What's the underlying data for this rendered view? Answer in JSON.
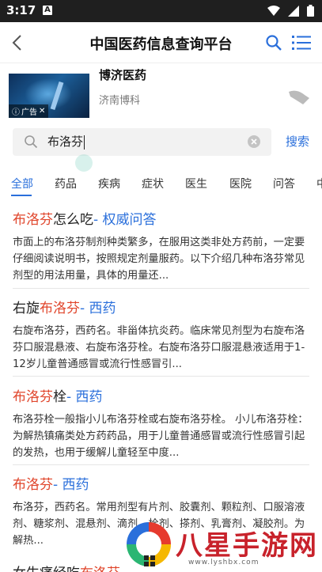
{
  "status_bar": {
    "time": "3:17",
    "badge": "A"
  },
  "nav": {
    "title": "中国医药信息查询平台"
  },
  "ad": {
    "title": "博济医药",
    "subtitle": "济南博科",
    "badge": "广告"
  },
  "search": {
    "value": "布洛芬",
    "button": "搜索"
  },
  "tabs": [
    {
      "label": "全部",
      "active": true
    },
    {
      "label": "药品"
    },
    {
      "label": "疾病"
    },
    {
      "label": "症状"
    },
    {
      "label": "医生"
    },
    {
      "label": "医院"
    },
    {
      "label": "问答"
    },
    {
      "label": "中"
    }
  ],
  "results": [
    {
      "title_hl": "布洛芬",
      "title_plain": "怎么吃",
      "title_tag": "- 权威问答",
      "body": "市面上的布洛芬制剂种类繁多，在服用这类非处方药前，一定要仔细阅读说明书，按照规定剂量服药。以下介绍几种布洛芬常见剂型的用法用量，具体的用量还..."
    },
    {
      "title_pre": "右旋",
      "title_hl": "布洛芬",
      "title_tag": "- 西药",
      "body": "右旋布洛芬，西药名。非甾体抗炎药。临床常见剂型为右旋布洛芬口服混悬液、右旋布洛芬栓。右旋布洛芬口服混悬液适用于1-12岁儿童普通感冒或流行性感冒引..."
    },
    {
      "title_hl": "布洛芬",
      "title_plain": "栓",
      "title_tag": "- 西药",
      "body": "布洛芬栓一般指小儿布洛芬栓或右旋布洛芬栓。 小儿布洛芬栓：为解热镇痛类处方药药品，用于儿童普通感冒或流行性感冒引起的发热，也用于缓解儿童轻至中度..."
    },
    {
      "title_hl": "布洛芬",
      "title_tag": "- 西药",
      "body": "布洛芬，西药名。常用剂型有片剂、胶囊剂、颗粒剂、口服溶液剂、糖浆剂、混悬剂、滴剂、栓剂、搽剂、乳膏剂、凝胶剂。为解热..."
    },
    {
      "title_pre": "女生痛经吃",
      "title_hl": "布洛芬"
    }
  ],
  "watermark": {
    "text": "八星手游网",
    "url": "www.lyshbx.com"
  },
  "colors": {
    "accent": "#2a6fdb",
    "highlight": "#e0452b"
  }
}
